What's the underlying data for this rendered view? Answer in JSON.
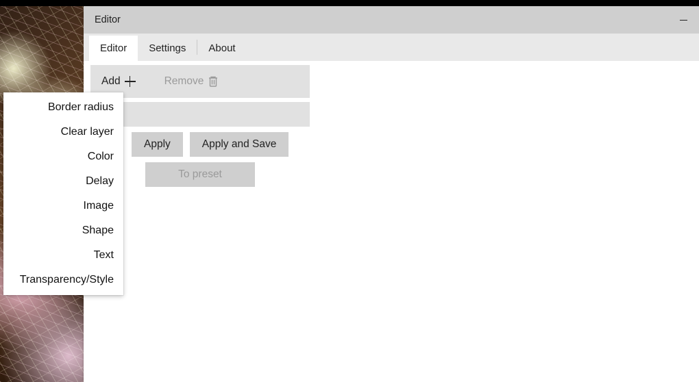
{
  "window": {
    "title": "Editor"
  },
  "tabs": {
    "editor": "Editor",
    "settings": "Settings",
    "about": "About"
  },
  "toolbar": {
    "add_label": "Add",
    "remove_label": "Remove",
    "apply_label": "Apply",
    "apply_and_save_label": "Apply and Save",
    "to_preset_label": "To preset"
  },
  "add_menu": {
    "items": [
      "Border radius",
      "Clear layer",
      "Color",
      "Delay",
      "Image",
      "Shape",
      "Text",
      "Transparency/Style"
    ]
  }
}
